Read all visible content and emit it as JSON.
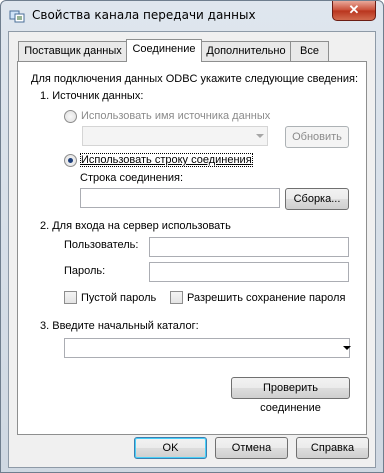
{
  "window": {
    "title": "Свойства канала передачи данных",
    "close_label": "✕"
  },
  "tabs": [
    {
      "label": "Поставщик данных"
    },
    {
      "label": "Соединение"
    },
    {
      "label": "Дополнительно"
    },
    {
      "label": "Все"
    }
  ],
  "connection": {
    "intro": "Для подключения данных ODBC укажите следующие сведения:",
    "section1_title": "1. Источник данных:",
    "use_dsn_label": "Использовать имя источника данных",
    "refresh_button": "Обновить",
    "use_conn_string_label": "Использовать строку соединения",
    "conn_string_label": "Строка соединения:",
    "conn_string_value": "",
    "build_button": "Сборка...",
    "section2_title": "2. Для входа на сервер использовать",
    "user_label": "Пользователь:",
    "user_value": "",
    "password_label": "Пароль:",
    "password_value": "",
    "empty_password_label": "Пустой пароль",
    "allow_save_password_label": "Разрешить сохранение пароля",
    "section3_title": "3. Введите начальный каталог:",
    "catalog_value": "",
    "test_button": "Проверить соединение"
  },
  "footer": {
    "ok": "OK",
    "cancel": "Отмена",
    "help": "Справка"
  },
  "state": {
    "dsn_selected": false,
    "conn_string_selected": true,
    "empty_password_checked": false,
    "allow_save_checked": false
  }
}
